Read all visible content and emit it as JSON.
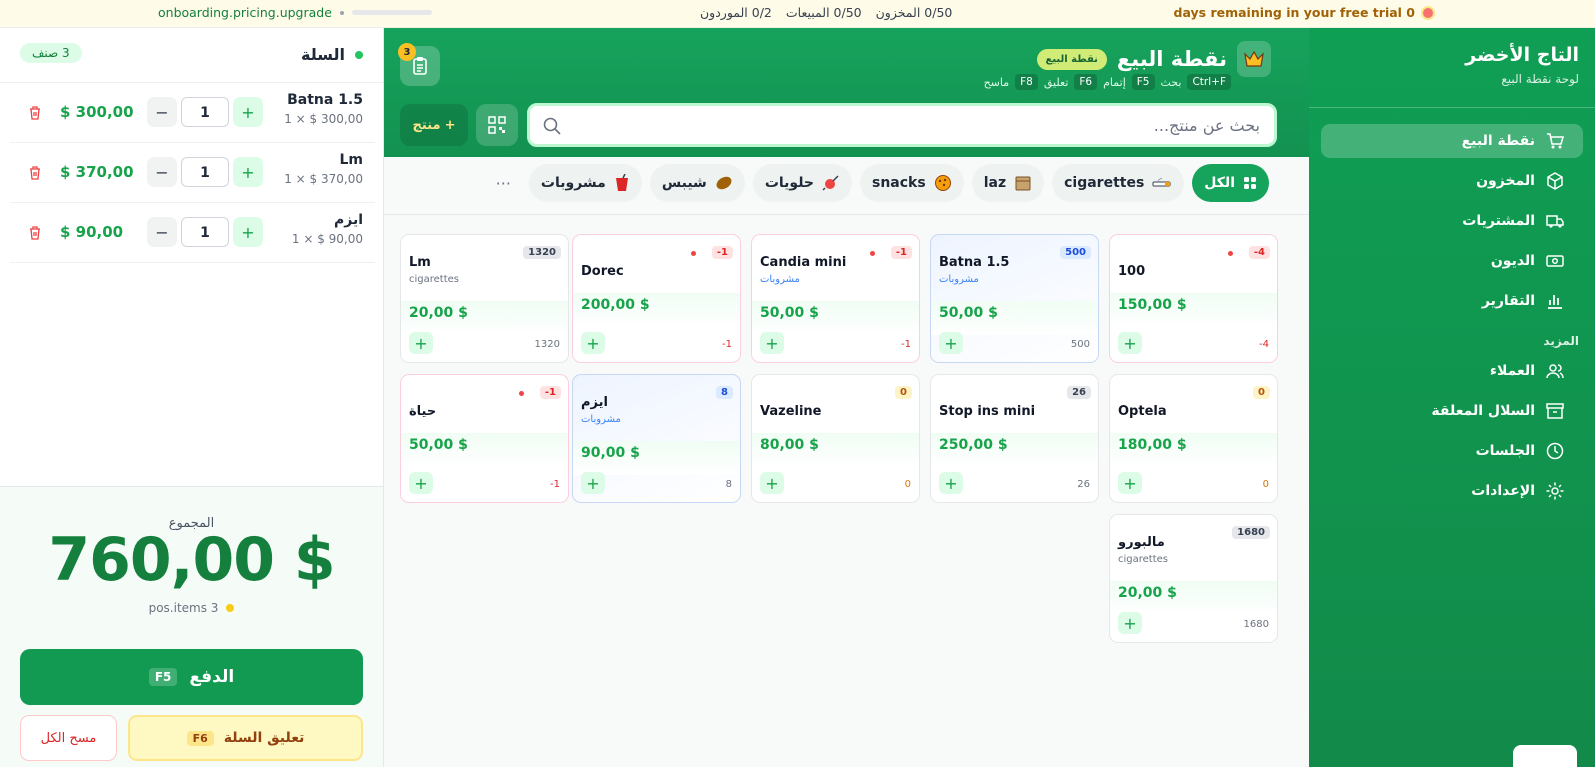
{
  "topbar": {
    "trial_text": "days remaining in your free trial 0",
    "stats": [
      "0/50 المخزون",
      "0/50 المبيعات",
      "0/2 الموردون"
    ],
    "onboarding": "onboarding.pricing.upgrade"
  },
  "sidebar": {
    "brand": "التاج الأخضر",
    "subtitle": "لوحة نقطة البيع",
    "items": [
      {
        "label": "نقطة البيع",
        "icon": "cart-icon"
      },
      {
        "label": "المخزون",
        "icon": "box-icon"
      },
      {
        "label": "المشتريات",
        "icon": "truck-icon"
      },
      {
        "label": "الديون",
        "icon": "banknote-icon"
      },
      {
        "label": "التقارير",
        "icon": "chart-icon"
      }
    ],
    "section": "المزيد",
    "more_items": [
      {
        "label": "العملاء",
        "icon": "users-icon"
      },
      {
        "label": "السلال المعلقة",
        "icon": "archive-icon"
      },
      {
        "label": "الجلسات",
        "icon": "clock-icon"
      },
      {
        "label": "الإعدادات",
        "icon": "gear-icon"
      }
    ]
  },
  "header": {
    "title": "نقطة البيع",
    "badge": "نقطة البيع",
    "shortcuts": [
      {
        "key": "Ctrl+F",
        "label": "بحث"
      },
      {
        "key": "F5",
        "label": "إتمام"
      },
      {
        "key": "F6",
        "label": "تعليق"
      },
      {
        "key": "F8",
        "label": "ماسح"
      }
    ],
    "held_count": "3",
    "search_placeholder": "بحث عن منتج...",
    "add_product": "منتج",
    "add_plus": "+"
  },
  "categories": [
    {
      "label": "الكل",
      "icon": "grid-icon",
      "active": true
    },
    {
      "label": "cigarettes",
      "icon": "cigarette-icon"
    },
    {
      "label": "laz",
      "icon": "package-icon"
    },
    {
      "label": "snacks",
      "icon": "cookie-icon"
    },
    {
      "label": "حلويات",
      "icon": "candy-icon"
    },
    {
      "label": "شيبس",
      "icon": "potato-icon"
    },
    {
      "label": "مشروبات",
      "icon": "cup-icon"
    }
  ],
  "categories_more": "···",
  "products": [
    {
      "name": "100",
      "category": "",
      "price": "150,00 $",
      "stock": "-4",
      "count": "-4",
      "type": "neg"
    },
    {
      "name": "Batna 1.5",
      "category": "مشروبات",
      "price": "50,00 $",
      "stock": "500",
      "count": "500",
      "type": "blue"
    },
    {
      "name": "Candia mini",
      "category": "مشروبات",
      "price": "50,00 $",
      "stock": "-1",
      "count": "-1",
      "type": "neg"
    },
    {
      "name": "Dorec",
      "category": "",
      "price": "200,00 $",
      "stock": "-1",
      "count": "-1",
      "type": "neg"
    },
    {
      "name": "Lm",
      "category": "cigarettes",
      "price": "20,00 $",
      "stock": "1320",
      "count": "1320",
      "type": "pos"
    },
    {
      "name": "Optela",
      "category": "",
      "price": "180,00 $",
      "stock": "0",
      "count": "0",
      "type": "zero"
    },
    {
      "name": "Stop ins mini",
      "category": "",
      "price": "250,00 $",
      "stock": "26",
      "count": "26",
      "type": "pos"
    },
    {
      "name": "Vazeline",
      "category": "",
      "price": "80,00 $",
      "stock": "0",
      "count": "0",
      "type": "zero"
    },
    {
      "name": "ايزم",
      "category": "مشروبات",
      "price": "90,00 $",
      "stock": "8",
      "count": "8",
      "type": "blue"
    },
    {
      "name": "حياة",
      "category": "",
      "price": "50,00 $",
      "stock": "-1",
      "count": "-1",
      "type": "neg"
    },
    {
      "name": "مالبورو",
      "category": "cigarettes",
      "price": "20,00 $",
      "stock": "1680",
      "count": "1680",
      "type": "pos"
    }
  ],
  "cart": {
    "title": "السلة",
    "count": "3 صنف",
    "items": [
      {
        "name": "Batna 1.5",
        "unit": "1 × $ 300,00",
        "qty": "1",
        "total": "$ 300,00"
      },
      {
        "name": "Lm",
        "unit": "1 × $ 370,00",
        "qty": "1",
        "total": "$ 370,00"
      },
      {
        "name": "ايزم",
        "unit": "1 × $ 90,00",
        "qty": "1",
        "total": "$ 90,00"
      }
    ],
    "total_label": "المجموع",
    "total": "760,00 $",
    "items_text": "pos.items 3",
    "pay_label": "الدفع",
    "pay_key": "F5",
    "hold_label": "تعليق السلة",
    "hold_key": "F6",
    "clear_label": "مسح الكل",
    "minus": "−",
    "plus": "+"
  }
}
